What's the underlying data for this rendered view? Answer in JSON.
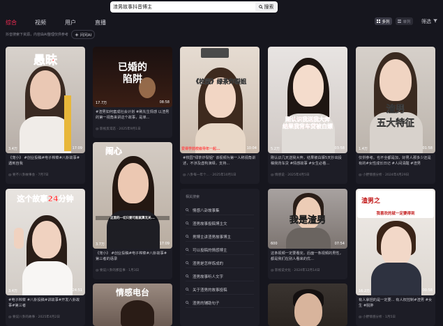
{
  "search": {
    "value": "渣男故事抖音博主",
    "button_label": "搜索"
  },
  "tabs": [
    "综合",
    "视频",
    "用户",
    "直播"
  ],
  "subbar": {
    "hint": "抖音搜索下资源，内容由AI整理仅供参考",
    "ai_label": "问问AI"
  },
  "view_toggle": {
    "grid_label": "多列",
    "list_label": "单列"
  },
  "filter_label": "筛选",
  "cards": [
    {
      "overlay": "愚昧",
      "likes": "3.4万",
      "duration": "17:09",
      "caption": "",
      "desc": "《宠小》 #创业投稿#电子榨菜#八卦故事#遇到自我",
      "meta": "@ 要不八卦故事会 · 7月7日"
    },
    {
      "overlay": "已婚的\n陷阱",
      "likes": "17.7万",
      "duration": "08:58",
      "caption": "",
      "desc": "#渣男如何套成社会计划 #刷先生情感 以渣男的第一视角来讲这个故事，是单...",
      "meta": "@ 影视反常态 · 2025年9月1日"
    },
    {
      "overlay": "《校园》绿茶炸裂姐",
      "likes": "3.7万",
      "duration": "10:04",
      "caption": "爱得学前校级导年一起...",
      "desc": "#校园\"绿茶炸裂姐\" 该视频为第一人称视角讲述，不涉及虚构演绎，支持...",
      "meta": "@ 八卦每一年个... · 2025年10月1日"
    },
    {
      "overlay": "刚认识我送我大奔\n结果我背车贷被白嫖",
      "likes": "5.2万",
      "duration": "03:58",
      "caption": "",
      "desc": "刚认识几天送我大奔，结果被白嫖5天抄出投稿我背车贷 #情感故事 #女生必看...",
      "meta": "@ 情感说 · 2025年4月5日"
    },
    {
      "overlay": "渣男\n五大特征",
      "likes": "1.4万",
      "duration": "01:58",
      "caption": "",
      "desc": "仅供参考。也不全都是加，好男人那多少还是有的#女性成长日记 #人间清醒 #渣男",
      "meta": "@ 小野情感分析 · 2024年4月29日"
    },
    {
      "overlay": "闹心",
      "likes": "3.7万",
      "duration": "17:09",
      "caption": "这里的一切只要可能就算无关...",
      "desc": "《宠小》 #创业投稿#电子榨菜#八卦故事#第三者的语录",
      "meta": "@ 要说八卦的那些事 · 1月3日"
    },
    {
      "overlay": "我是渣男",
      "likes": "600",
      "duration": "07:54",
      "caption": "",
      "desc": "这条视频一定要看完，后面一条视频的男性，都是我们在别人看来的优...",
      "meta": "@ 影视说文化 · 2024年12月14日"
    },
    {
      "overlay": "渣男之",
      "likes": "16.2万",
      "duration": "00:58",
      "caption": "我喜欢的就一定要得到",
      "desc": "有人拿捏的是一定要... 有人权控制#渣男 #女生 #脱胖",
      "meta": "@ 小野情感分析 · 1月5日"
    },
    {
      "overlay": "这个故事24分钟",
      "likes": "3.4万",
      "duration": "24:51",
      "caption": "",
      "desc": "#电子榨菜 #八卦投稿#讲故事#开发八卦故事#第三者",
      "meta": "@ 要说八卦的故事 · 2025年4月2日"
    },
    {
      "overlay": "情感电台",
      "likes": "",
      "duration": "",
      "caption": "",
      "desc": "",
      "meta": ""
    },
    {
      "overlay": "",
      "likes": "",
      "duration": "",
      "caption": "",
      "desc": "",
      "meta": ""
    }
  ],
  "related": {
    "title": "相关搜索",
    "items": [
      "情感八卦故事集",
      "渣男故事投稿博主文",
      "男博主讲渣男故事博主",
      "可以投稿的情感博主",
      "渣男是怎样炼成的",
      "渣男故事听人文字",
      "关于渣男的故事投稿",
      "渣男的辅助句子"
    ]
  }
}
